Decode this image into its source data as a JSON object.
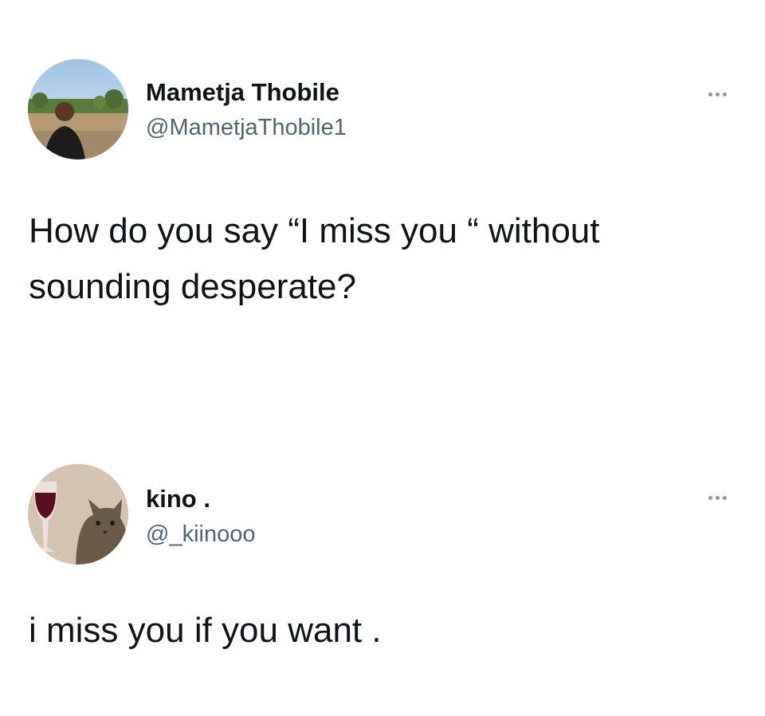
{
  "tweets": [
    {
      "display_name": "Mametja Thobile",
      "handle": "@MametjaThobile1",
      "text": "How do you say “I miss you “ without\nsounding desperate?",
      "avatar_icon": "profile-photo-man-outdoors",
      "more_icon": "more-dots-icon"
    },
    {
      "display_name": "kino .",
      "handle": "@_kiinooo",
      "text": "i miss you if you want .",
      "avatar_icon": "profile-photo-cat-with-wine",
      "more_icon": "more-dots-icon"
    }
  ],
  "colors": {
    "text": "#0f1419",
    "secondary_text": "#536471",
    "more_dots": "#8b98a5",
    "background": "#ffffff"
  }
}
